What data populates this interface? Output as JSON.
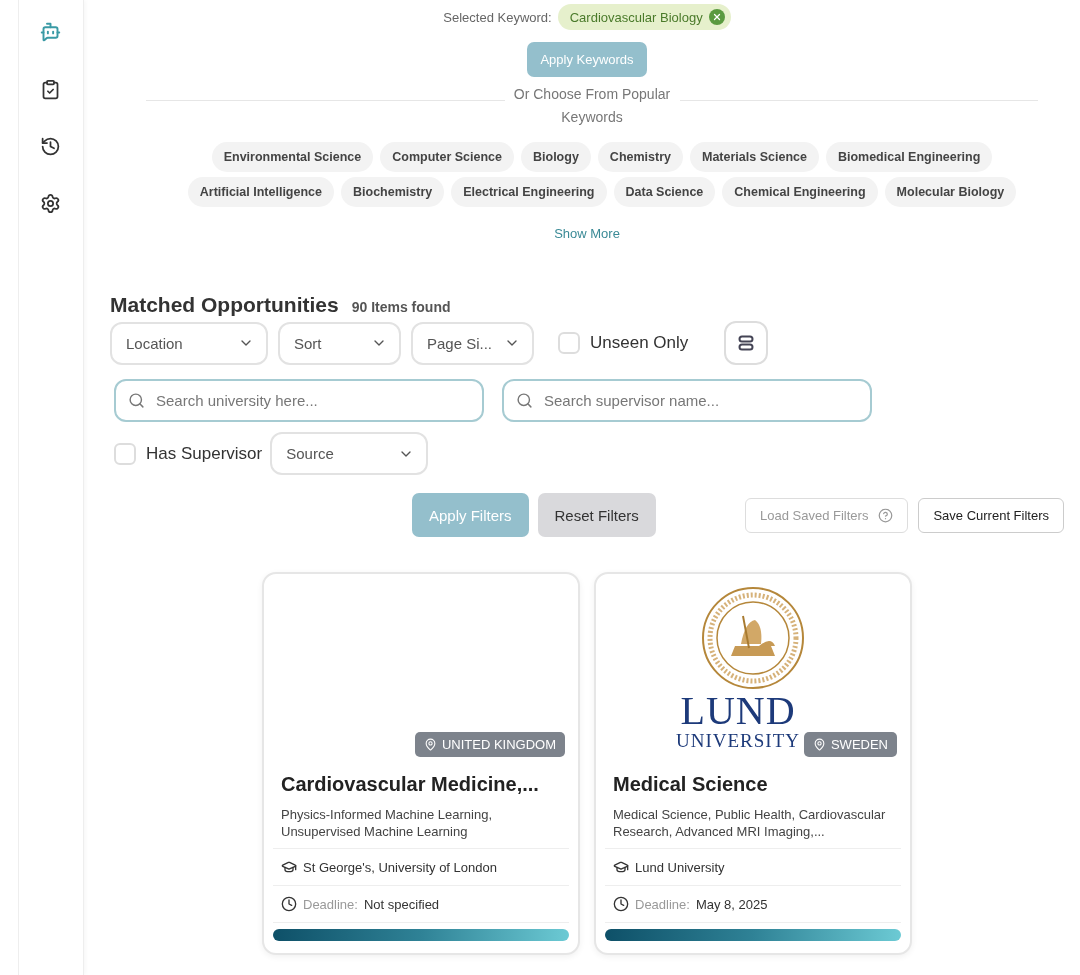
{
  "sidebar": {
    "items": [
      {
        "selected": true
      },
      {
        "selected": false
      },
      {
        "selected": false
      },
      {
        "selected": false
      }
    ]
  },
  "keywords": {
    "selected_label": "Selected Keyword:",
    "selected": [
      {
        "label": "Cardiovascular Biology"
      }
    ],
    "apply_button": "Apply Keywords",
    "divider_text": "Or Choose From Popular Keywords",
    "popular": [
      "Environmental Science",
      "Computer Science",
      "Biology",
      "Chemistry",
      "Materials Science",
      "Biomedical Engineering",
      "Artificial Intelligence",
      "Biochemistry",
      "Electrical Engineering",
      "Data Science",
      "Chemical Engineering",
      "Molecular Biology"
    ],
    "show_more": "Show More"
  },
  "results": {
    "title": "Matched Opportunities",
    "count": "90 Items found",
    "selects": [
      {
        "label": "Location"
      },
      {
        "label": "Sort"
      },
      {
        "label": "Page Si..."
      }
    ],
    "unseen_only": {
      "label": "Unseen Only",
      "checked": false
    },
    "search_university": {
      "placeholder": "Search university here..."
    },
    "search_supervisor": {
      "placeholder": "Search supervisor name..."
    },
    "has_supervisor": {
      "label": "Has Supervisor",
      "checked": false
    },
    "source_select": {
      "label": "Source"
    },
    "apply_filters": {
      "label": "Apply Filters",
      "disabled": true
    },
    "reset_filters": "Reset Filters",
    "load_saved": {
      "label": "Load Saved Filters",
      "disabled": true
    },
    "save_current": "Save Current Filters",
    "cards": [
      {
        "country": "UNITED KINGDOM",
        "title": "Cardiovascular Medicine,...",
        "topics": "Physics-Informed Machine Learning, Unsupervised Machine Learning",
        "university": "St George's, University of London",
        "deadline_label": "Deadline:",
        "deadline": "Not specified"
      },
      {
        "logo": [
          "LUND",
          "UNIVERSITY"
        ],
        "country": "SWEDEN",
        "title": "Medical Science",
        "topics": "Medical Science, Public Health, Cardiovascular Research, Advanced MRI Imaging,...",
        "university": "Lund University",
        "deadline_label": "Deadline:",
        "deadline": "May 8, 2025"
      }
    ]
  }
}
